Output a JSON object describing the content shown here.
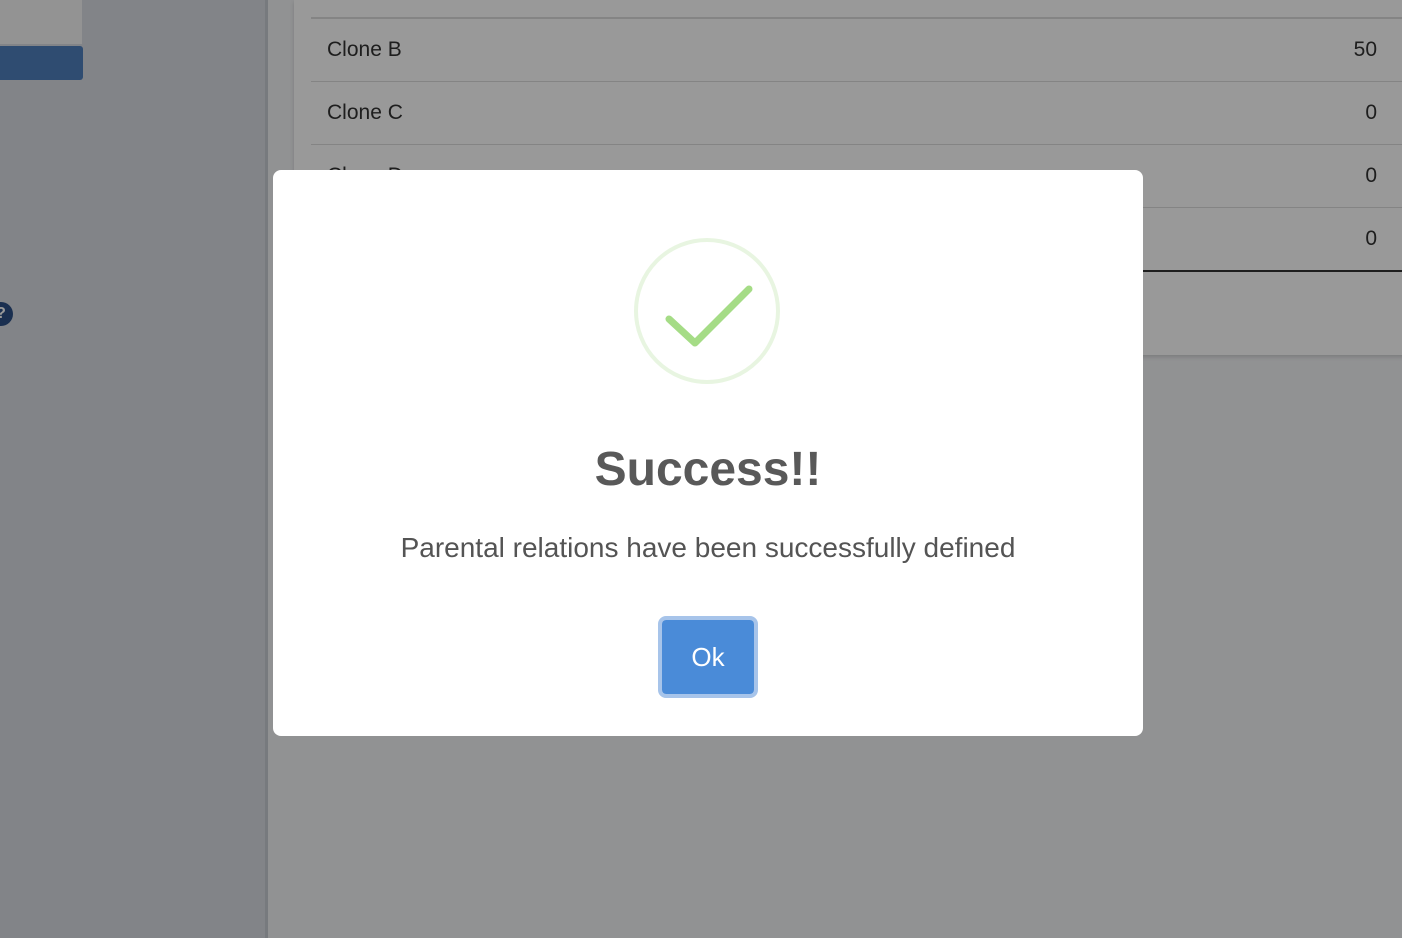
{
  "table": {
    "rows": [
      {
        "name": "Clone B",
        "value": "50"
      },
      {
        "name": "Clone C",
        "value": "0"
      },
      {
        "name": "Clone D",
        "value": "0"
      },
      {
        "name": "",
        "value": "0"
      }
    ]
  },
  "modal": {
    "icon": "success-check-icon",
    "title": "Success!!",
    "message": "Parental relations have been successfully defined",
    "ok_label": "Ok"
  },
  "colors": {
    "success_green": "#a5dc86",
    "button_blue": "#4a8bd8",
    "sidebar_active": "#4f7fbd"
  }
}
